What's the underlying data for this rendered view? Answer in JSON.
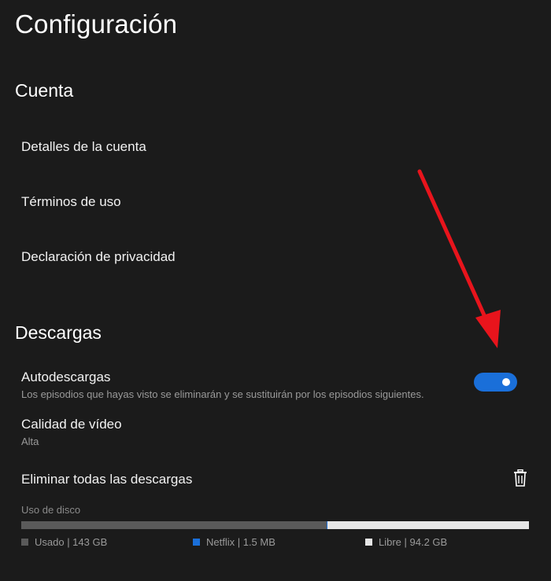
{
  "page": {
    "title": "Configuración"
  },
  "account": {
    "title": "Cuenta",
    "items": [
      {
        "label": "Detalles de la cuenta"
      },
      {
        "label": "Términos de uso"
      },
      {
        "label": "Declaración de privacidad"
      }
    ]
  },
  "downloads": {
    "title": "Descargas",
    "autodownload": {
      "label": "Autodescargas",
      "description": "Los episodios que hayas visto se eliminarán y se sustituirán por los episodios siguientes.",
      "enabled": true
    },
    "video_quality": {
      "label": "Calidad de vídeo",
      "value": "Alta"
    },
    "delete_all": {
      "label": "Eliminar todas las descargas"
    },
    "disk_usage": {
      "label": "Uso de disco",
      "used_fraction": 0.602,
      "legend": [
        {
          "label": "Usado | 143 GB",
          "color": "#5a5a5a"
        },
        {
          "label": "Netflix | 1.5 MB",
          "color": "#1a6fd9"
        },
        {
          "label": "Libre | 94.2 GB",
          "color": "#e6e6e6"
        }
      ]
    }
  },
  "annotation": {
    "arrow_color": "#e8141c"
  },
  "colors": {
    "background": "#1b1b1b",
    "accent": "#1a6fd9"
  }
}
